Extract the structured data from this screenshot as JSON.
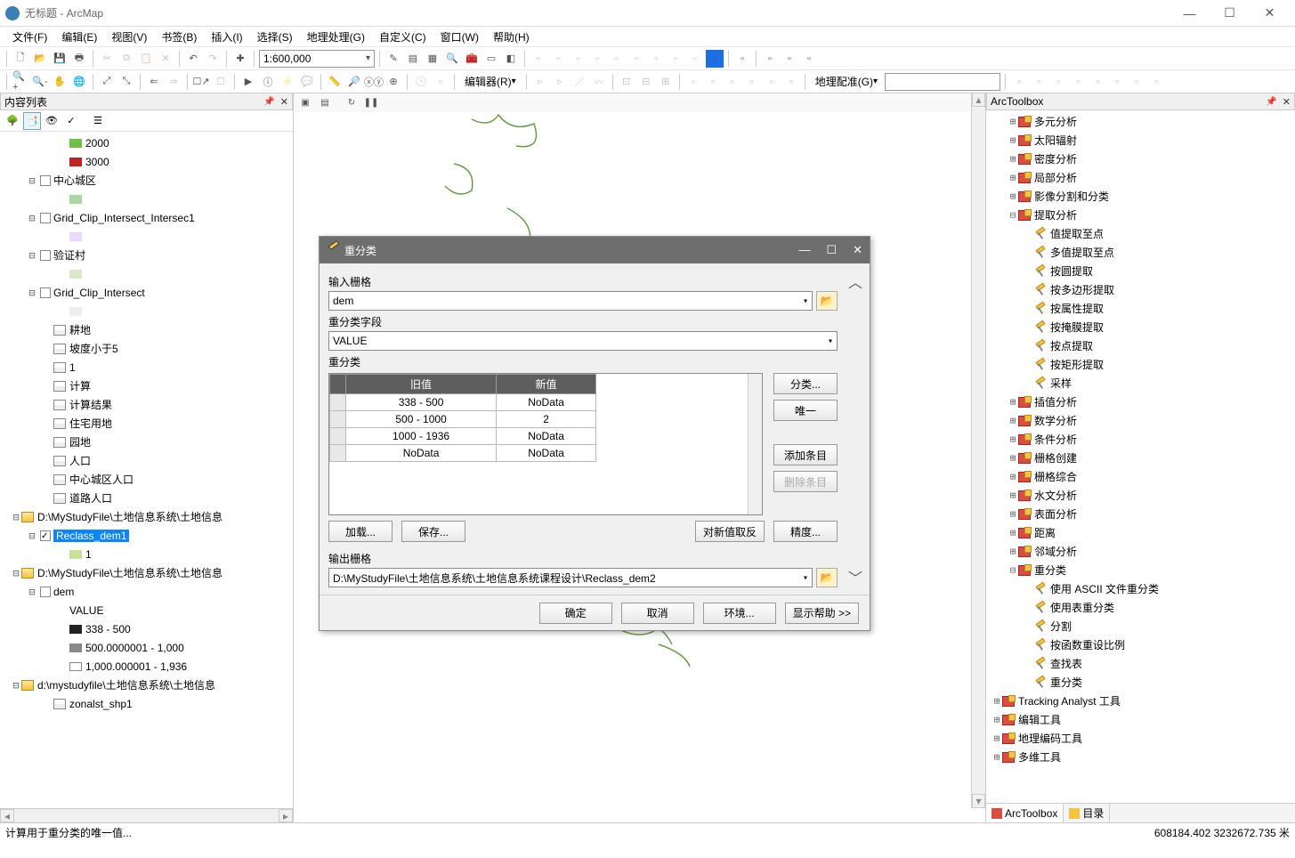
{
  "window": {
    "title": "无标题 - ArcMap"
  },
  "menu": [
    "文件(F)",
    "编辑(E)",
    "视图(V)",
    "书签(B)",
    "插入(I)",
    "选择(S)",
    "地理处理(G)",
    "自定义(C)",
    "窗口(W)",
    "帮助(H)"
  ],
  "toolbar": {
    "scale": "1:600,000",
    "editor_label": "编辑器(R)",
    "georef_label": "地理配准(G)"
  },
  "toc": {
    "title": "内容列表",
    "items": [
      {
        "indent": 3,
        "swatch": "#6fbf4a",
        "label": "2000"
      },
      {
        "indent": 3,
        "swatch": "#c02323",
        "label": "3000"
      },
      {
        "indent": 1,
        "exp": "⊟",
        "cb": "off",
        "label": "中心城区"
      },
      {
        "indent": 3,
        "swatch": "#a9d9a3",
        "label": ""
      },
      {
        "indent": 1,
        "exp": "⊟",
        "cb": "off",
        "label": "Grid_Clip_Intersect_Intersec1"
      },
      {
        "indent": 3,
        "swatch": "#ecd9ff",
        "label": ""
      },
      {
        "indent": 1,
        "exp": "⊟",
        "cb": "off",
        "label": "验证村"
      },
      {
        "indent": 3,
        "swatch": "#d9e8c6",
        "label": ""
      },
      {
        "indent": 1,
        "exp": "⊟",
        "cb": "off",
        "label": "Grid_Clip_Intersect"
      },
      {
        "indent": 3,
        "swatch": "#eee",
        "label": ""
      },
      {
        "indent": 2,
        "tbl": true,
        "label": "耕地"
      },
      {
        "indent": 2,
        "tbl": true,
        "label": "坡度小于5"
      },
      {
        "indent": 2,
        "tbl": true,
        "label": "1"
      },
      {
        "indent": 2,
        "tbl": true,
        "label": "计算"
      },
      {
        "indent": 2,
        "tbl": true,
        "label": "计算结果"
      },
      {
        "indent": 2,
        "tbl": true,
        "label": "住宅用地"
      },
      {
        "indent": 2,
        "tbl": true,
        "label": "园地"
      },
      {
        "indent": 2,
        "tbl": true,
        "label": "人口"
      },
      {
        "indent": 2,
        "tbl": true,
        "label": "中心城区人口"
      },
      {
        "indent": 2,
        "tbl": true,
        "label": "道路人口"
      },
      {
        "indent": 0,
        "exp": "⊟",
        "fold": true,
        "label": "D:\\MyStudyFile\\土地信息系统\\土地信息"
      },
      {
        "indent": 1,
        "exp": "⊟",
        "cb": "on",
        "sel": true,
        "label": "Reclass_dem1"
      },
      {
        "indent": 3,
        "swatch": "#c8e09a",
        "label": "1"
      },
      {
        "indent": 0,
        "exp": "⊟",
        "fold": true,
        "label": "D:\\MyStudyFile\\土地信息系统\\土地信息"
      },
      {
        "indent": 1,
        "exp": "⊟",
        "cb": "off",
        "label": "dem"
      },
      {
        "indent": 3,
        "label": "VALUE"
      },
      {
        "indent": 3,
        "swatch": "#222",
        "label": "338 - 500"
      },
      {
        "indent": 3,
        "swatch": "#888",
        "label": "500.0000001 - 1,000"
      },
      {
        "indent": 3,
        "swatch": "#fff",
        "border": true,
        "label": "1,000.000001 - 1,936"
      },
      {
        "indent": 0,
        "exp": "⊟",
        "fold": true,
        "label": "d:\\mystudyfile\\土地信息系统\\土地信息"
      },
      {
        "indent": 2,
        "tbl": true,
        "label": "zonalst_shp1"
      }
    ]
  },
  "arctoolbox": {
    "title": "ArcToolbox",
    "items": [
      {
        "indent": 1,
        "exp": "⊞",
        "type": "tbx",
        "label": "多元分析"
      },
      {
        "indent": 1,
        "exp": "⊞",
        "type": "tbx",
        "label": "太阳辐射"
      },
      {
        "indent": 1,
        "exp": "⊞",
        "type": "tbx",
        "label": "密度分析"
      },
      {
        "indent": 1,
        "exp": "⊞",
        "type": "tbx",
        "label": "局部分析"
      },
      {
        "indent": 1,
        "exp": "⊞",
        "type": "tbx",
        "label": "影像分割和分类"
      },
      {
        "indent": 1,
        "exp": "⊟",
        "type": "tbx",
        "label": "提取分析"
      },
      {
        "indent": 2,
        "type": "tool",
        "label": "值提取至点"
      },
      {
        "indent": 2,
        "type": "tool",
        "label": "多值提取至点"
      },
      {
        "indent": 2,
        "type": "tool",
        "label": "按圆提取"
      },
      {
        "indent": 2,
        "type": "tool",
        "label": "按多边形提取"
      },
      {
        "indent": 2,
        "type": "tool",
        "label": "按属性提取"
      },
      {
        "indent": 2,
        "type": "tool",
        "label": "按掩膜提取"
      },
      {
        "indent": 2,
        "type": "tool",
        "label": "按点提取"
      },
      {
        "indent": 2,
        "type": "tool",
        "label": "按矩形提取"
      },
      {
        "indent": 2,
        "type": "tool",
        "label": "采样"
      },
      {
        "indent": 1,
        "exp": "⊞",
        "type": "tbx",
        "label": "插值分析"
      },
      {
        "indent": 1,
        "exp": "⊞",
        "type": "tbx",
        "label": "数学分析"
      },
      {
        "indent": 1,
        "exp": "⊞",
        "type": "tbx",
        "label": "条件分析"
      },
      {
        "indent": 1,
        "exp": "⊞",
        "type": "tbx",
        "label": "栅格创建"
      },
      {
        "indent": 1,
        "exp": "⊞",
        "type": "tbx",
        "label": "栅格综合"
      },
      {
        "indent": 1,
        "exp": "⊞",
        "type": "tbx",
        "label": "水文分析"
      },
      {
        "indent": 1,
        "exp": "⊞",
        "type": "tbx",
        "label": "表面分析"
      },
      {
        "indent": 1,
        "exp": "⊞",
        "type": "tbx",
        "label": "距离"
      },
      {
        "indent": 1,
        "exp": "⊞",
        "type": "tbx",
        "label": "邻域分析"
      },
      {
        "indent": 1,
        "exp": "⊟",
        "type": "tbx",
        "label": "重分类"
      },
      {
        "indent": 2,
        "type": "tool",
        "label": "使用 ASCII 文件重分类"
      },
      {
        "indent": 2,
        "type": "tool",
        "label": "使用表重分类"
      },
      {
        "indent": 2,
        "type": "tool",
        "label": "分割"
      },
      {
        "indent": 2,
        "type": "tool",
        "label": "按函数重设比例"
      },
      {
        "indent": 2,
        "type": "tool",
        "label": "查找表"
      },
      {
        "indent": 2,
        "type": "tool",
        "label": "重分类"
      },
      {
        "indent": 0,
        "exp": "⊞",
        "type": "tbx",
        "label": "Tracking Analyst 工具"
      },
      {
        "indent": 0,
        "exp": "⊞",
        "type": "tbx",
        "label": "编辑工具"
      },
      {
        "indent": 0,
        "exp": "⊞",
        "type": "tbx",
        "label": "地理编码工具"
      },
      {
        "indent": 0,
        "exp": "⊞",
        "type": "tbx",
        "label": "多维工具"
      }
    ],
    "tabs": [
      "ArcToolbox",
      "目录"
    ]
  },
  "dialog": {
    "title": "重分类",
    "labels": {
      "input_raster": "输入栅格",
      "reclass_field": "重分类字段",
      "reclass": "重分类",
      "output": "输出栅格"
    },
    "input_raster_value": "dem",
    "reclass_field_value": "VALUE",
    "table": {
      "headers": [
        "旧值",
        "新值"
      ],
      "rows": [
        [
          "338 - 500",
          "NoData"
        ],
        [
          "500 - 1000",
          "2"
        ],
        [
          "1000 - 1936",
          "NoData"
        ],
        [
          "NoData",
          "NoData"
        ]
      ]
    },
    "buttons": {
      "classify": "分类...",
      "unique": "唯一",
      "add": "添加条目",
      "delete": "删除条目",
      "load": "加载...",
      "save": "保存...",
      "reverse": "对新值取反",
      "precision": "精度...",
      "ok": "确定",
      "cancel": "取消",
      "env": "环境...",
      "help": "显示帮助 >>"
    },
    "output_value": "D:\\MyStudyFile\\土地信息系统\\土地信息系统课程设计\\Reclass_dem2"
  },
  "status": {
    "left": "计算用于重分类的唯一值...",
    "right": "608184.402 3232672.735 米"
  }
}
